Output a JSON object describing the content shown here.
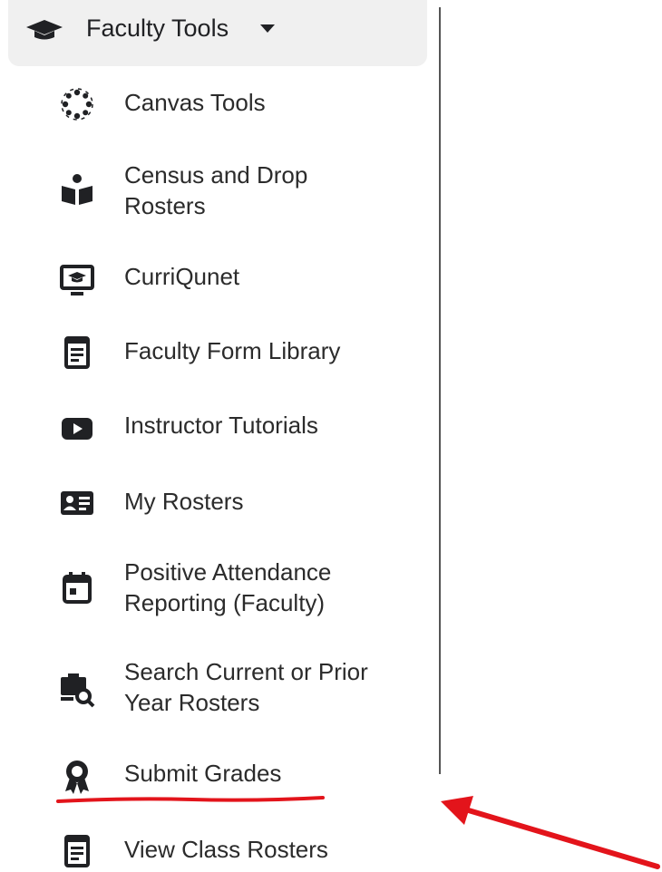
{
  "header": {
    "label": "Faculty Tools",
    "icon": "graduation-cap-icon",
    "caret_icon": "caret-down-icon"
  },
  "items": [
    {
      "label_lines": [
        "Canvas Tools"
      ],
      "icon": "canvas-logo-icon"
    },
    {
      "label_lines": [
        "Census and Drop",
        "Rosters"
      ],
      "icon": "book-reader-icon"
    },
    {
      "label_lines": [
        "CurriQunet"
      ],
      "icon": "monitor-teacher-icon"
    },
    {
      "label_lines": [
        "Faculty Form Library"
      ],
      "icon": "notepad-icon"
    },
    {
      "label_lines": [
        "Instructor Tutorials"
      ],
      "icon": "youtube-play-icon"
    },
    {
      "label_lines": [
        "My Rosters"
      ],
      "icon": "id-card-icon"
    },
    {
      "label_lines": [
        "Positive Attendance",
        "Reporting (Faculty)"
      ],
      "icon": "calendar-icon"
    },
    {
      "label_lines": [
        "Search Current or Prior",
        "Year Rosters"
      ],
      "icon": "search-roster-icon"
    },
    {
      "label_lines": [
        "Submit Grades"
      ],
      "icon": "award-ribbon-icon"
    },
    {
      "label_lines": [
        "View Class Rosters"
      ],
      "icon": "notepad-icon"
    }
  ],
  "annotation": {
    "underline_color": "#e3141b",
    "arrow_color": "#e3141b"
  }
}
